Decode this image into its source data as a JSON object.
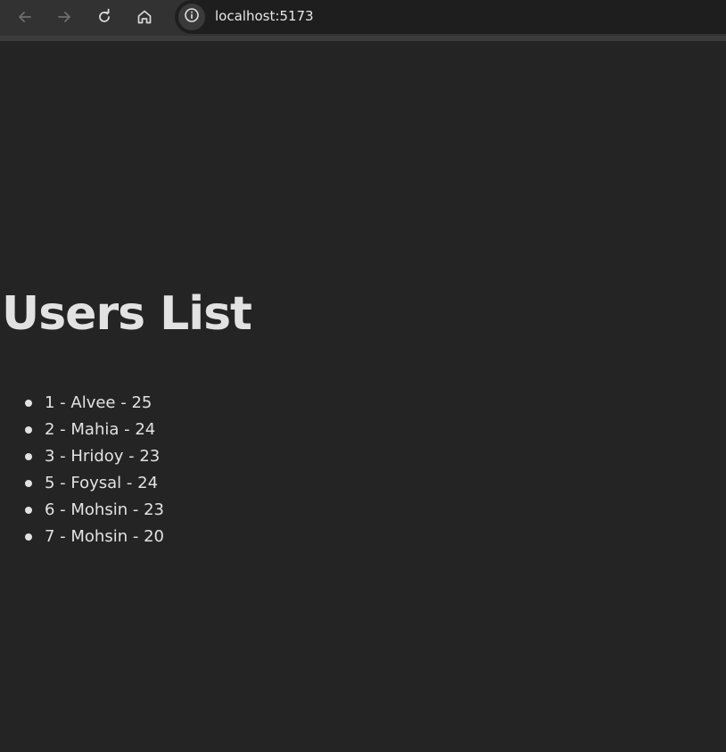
{
  "browser": {
    "url": "localhost:5173",
    "icons": {
      "back": "arrow-left-icon",
      "forward": "arrow-right-icon",
      "reload": "reload-icon",
      "home": "home-icon",
      "site_info": "info-icon"
    }
  },
  "page": {
    "title": "Users List",
    "users": [
      "1 - Alvee - 25",
      "2 - Mahia - 24",
      "3 - Hridoy - 23",
      "5 - Foysal - 24",
      "6 - Mohsin - 23",
      "7 - Mohsin - 20"
    ]
  },
  "colors": {
    "background": "#242424",
    "toolbar": "#323232",
    "text": "#dedede"
  }
}
